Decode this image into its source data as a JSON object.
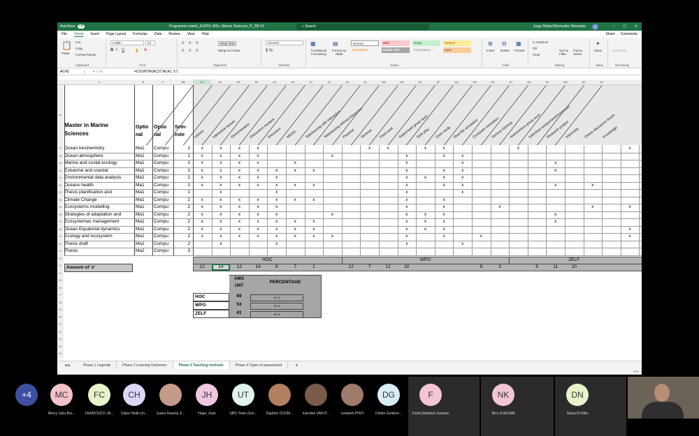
{
  "excel": {
    "autosave": "AutoSave",
    "autosave_state": "Off",
    "title": "Programme matrix_ESPOL-MSc. Marine Sciences_IT_R8 V3",
    "search": "Search",
    "user": "Jorge Rafael Bermudez Monsalve",
    "user_initials": "JR",
    "menu": [
      "File",
      "Home",
      "Insert",
      "Page Layout",
      "Formulas",
      "Data",
      "Review",
      "View",
      "Help"
    ],
    "share": "Share",
    "comments": "Comments",
    "ribbon": {
      "paste": "Paste",
      "cut": "Cut",
      "copy": "Copy",
      "format_painter": "Format Painter",
      "clipboard": "Clipboard",
      "font": "Calibri",
      "size": "22",
      "font_group": "Font",
      "wrap": "Wrap Text",
      "merge": "Merge & Center",
      "alignment": "Alignment",
      "number_format": "General",
      "number": "Number",
      "cond": "Conditional Formatting",
      "format_table": "Format as Table",
      "styles": [
        "Normal",
        "Bad",
        "Good",
        "Neutral",
        "Calculation",
        "Check Cell",
        "Explanatory ...",
        "Input"
      ],
      "styles_group": "Styles",
      "insert": "Insert",
      "delete": "Delete",
      "format": "Format",
      "cells": "Cells",
      "autosum": "AutoSum",
      "fill": "Fill",
      "clear": "Clear",
      "sort": "Sort & Filter",
      "find": "Find & Select",
      "editing": "Editing",
      "ideas": "Ideas",
      "ideas_group": "Ideas",
      "sensitivity": "Sensitivity",
      "sensitivity_group": "Sensitivity"
    },
    "namebox": "AC43",
    "formula": "=COUNTIF(AC27:AC41,\"x\")",
    "cols": [
      "A",
      "B",
      "C",
      "AB",
      "AC",
      "AD",
      "AE",
      "AF",
      "AG",
      "AH",
      "AI",
      "AJ",
      "AK",
      "AL",
      "AM",
      "AN",
      "AO",
      "AP",
      "AQ",
      "AR",
      "AS",
      "AT",
      "AU",
      "AV",
      "AW",
      "AX",
      "AY"
    ],
    "rows": [
      "26",
      "27",
      "28",
      "29",
      "30",
      "31",
      "32",
      "33",
      "34",
      "35",
      "36",
      "37",
      "38",
      "39",
      "40",
      "41",
      "42",
      "43",
      "44",
      "45",
      "46",
      "47",
      "48",
      "49",
      "50",
      "51",
      "52",
      "53",
      "54",
      "55",
      "56",
      "57",
      "58",
      "59",
      "60"
    ],
    "header": {
      "title": "Master in Marine Sciences",
      "optional1": "Optio nal",
      "optional2": "Optio nal",
      "semester": "Sem- este"
    },
    "methods": [
      "Lecture",
      "Interactive lecture",
      "Demonstration",
      "Discussion moment",
      "Excursion",
      "MOOC",
      "Teleclassing with interaction",
      "Teleclassing without interaction",
      "Practical",
      "Seminar",
      "Field work",
      "Supervised group work",
      "Role play",
      "Case study",
      "Real-life simulation",
      "Computer simulation",
      "Serious Gaming",
      "Autonomous group work",
      "Individual assignment/Homework",
      "Research project",
      "Internship",
      "Online discussion forum",
      "Knowledge"
    ],
    "courses": [
      {
        "name": "Ocean biochemistry",
        "o1": "Ma1",
        "o2": "Compu",
        "sem": "1"
      },
      {
        "name": "Ocean-atmosphere",
        "o1": "Ma1",
        "o2": "Compu",
        "sem": "1"
      },
      {
        "name": "Marine and costal ecology",
        "o1": "Ma1",
        "o2": "Compu",
        "sem": "1"
      },
      {
        "name": "Estuarine and coastal",
        "o1": "Ma1",
        "o2": "Compu",
        "sem": "1"
      },
      {
        "name": "Environmental data analysis",
        "o1": "Ma1",
        "o2": "Compu",
        "sem": "1"
      },
      {
        "name": "Oceans health",
        "o1": "Ma1",
        "o2": "Compu",
        "sem": "1"
      },
      {
        "name": "Thesis planification and",
        "o1": "Ma1",
        "o2": "Compu",
        "sem": "1"
      },
      {
        "name": "Climate Change",
        "o1": "Ma1",
        "o2": "Compu",
        "sem": "2"
      },
      {
        "name": "Ecosystems modelling",
        "o1": "Ma1",
        "o2": "Compu",
        "sem": "2"
      },
      {
        "name": "Strategies of adaptation and",
        "o1": "Ma1",
        "o2": "Compu",
        "sem": "2"
      },
      {
        "name": "Ecosystemas management",
        "o1": "Ma1",
        "o2": "Compu",
        "sem": "2"
      },
      {
        "name": "Ocean Equatorial dynamics",
        "o1": "Ma1",
        "o2": "Compu",
        "sem": "2"
      },
      {
        "name": "Ecology and ecosystem",
        "o1": "Ma1",
        "o2": "Compu",
        "sem": "2"
      },
      {
        "name": "Thesis draft",
        "o1": "Ma1",
        "o2": "Compu",
        "sem": "2"
      },
      {
        "name": "Thesis",
        "o1": "Ma2",
        "o2": "Compu",
        "sem": "3"
      }
    ],
    "marks": [
      "xxxx_____xx_xx___x_____xxx____x",
      "xxxx___x___x_xx__________xxx_____x",
      "xxxx_x_____x__x____x____xxx",
      "xxxxxxx____x_xx____x____xxx",
      "xxxxx______xxxx_____________xx_____x",
      "xxxxxxx____x_xx____x_x_____x_x",
      "_x__x______x__x",
      "xxxxxxx____x_x",
      "xxxxx______x_x__x____x_x___xxx",
      "xxxxx__x___xxx_____x_______x",
      "xxxxxxx____xxx_____x_______xxx",
      "xxxxxxx____xxx_________x___x_x",
      "xxxxxxxx___x_x_x_______x___xx",
      "_x__x______x__x",
      ""
    ],
    "groups": [
      {
        "label": "HOC"
      },
      {
        "label": "WPO"
      },
      {
        "label": "ZELF"
      }
    ],
    "amount_label": "Amount of 'x'",
    "amounts": [
      "12",
      "14",
      "12",
      "14",
      "9",
      "7",
      "1",
      "",
      "12",
      "7",
      "12",
      "10",
      "",
      "",
      "",
      "9",
      "3",
      "",
      "9",
      "11",
      "10",
      "",
      "",
      "",
      "5"
    ],
    "summary": {
      "col_amount": "AMO UNT",
      "col_pct": "PERCENTAGE",
      "rows": [
        {
          "label": "HOC",
          "amount": "69",
          "pct": "42 %"
        },
        {
          "label": "WPO",
          "amount": "53",
          "pct": "33 %"
        },
        {
          "label": "ZELF",
          "amount": "41",
          "pct": "25 %"
        }
      ]
    },
    "sheets": [
      "Phase 1 Legende",
      "Phase 2 Learning Outcomes",
      "Phase 3 Teaching methods",
      "Phase 4 Types of assessment"
    ],
    "zoom": "70%"
  },
  "participants": [
    {
      "initials": "+4",
      "name": "",
      "color": "#3c4fa0"
    },
    {
      "initials": "MC",
      "name": "Mercy Julia Bor...",
      "color": "#f4c2c9"
    },
    {
      "initials": "FC",
      "name": "FRANCISCO JA...",
      "color": "#e6f4c9"
    },
    {
      "initials": "CH",
      "name": "Claire Heillo (In...",
      "color": "#dcd6f7"
    },
    {
      "initials": "",
      "name": "Juana Susana Ji...",
      "color": "#c49a8a"
    },
    {
      "initials": "JH",
      "name": "Hupe, Jean",
      "color": "#f2c6e0"
    },
    {
      "initials": "UT",
      "name": "UBO Team (Invi...",
      "color": "#e0f3ec"
    },
    {
      "initials": "",
      "name": "Daphné COOM...",
      "color": "#b08060"
    },
    {
      "initials": "",
      "name": "Karolien VAN P...",
      "color": "#7a5a4a"
    },
    {
      "initials": "",
      "name": "Liesbeth PINTI",
      "color": "#a07a6a"
    },
    {
      "initials": "DG",
      "name": "Dimitri Gutiérre...",
      "color": "#d9eef4"
    },
    {
      "initials": "F",
      "name": "Farid.Dahdouh-Guebas",
      "color": "#f4c6d4"
    },
    {
      "initials": "NK",
      "name": "Nico KOEDAM",
      "color": "#f4c6d4"
    },
    {
      "initials": "DN",
      "name": "Diana Di Nitto",
      "color": "#e6f4c9"
    }
  ]
}
